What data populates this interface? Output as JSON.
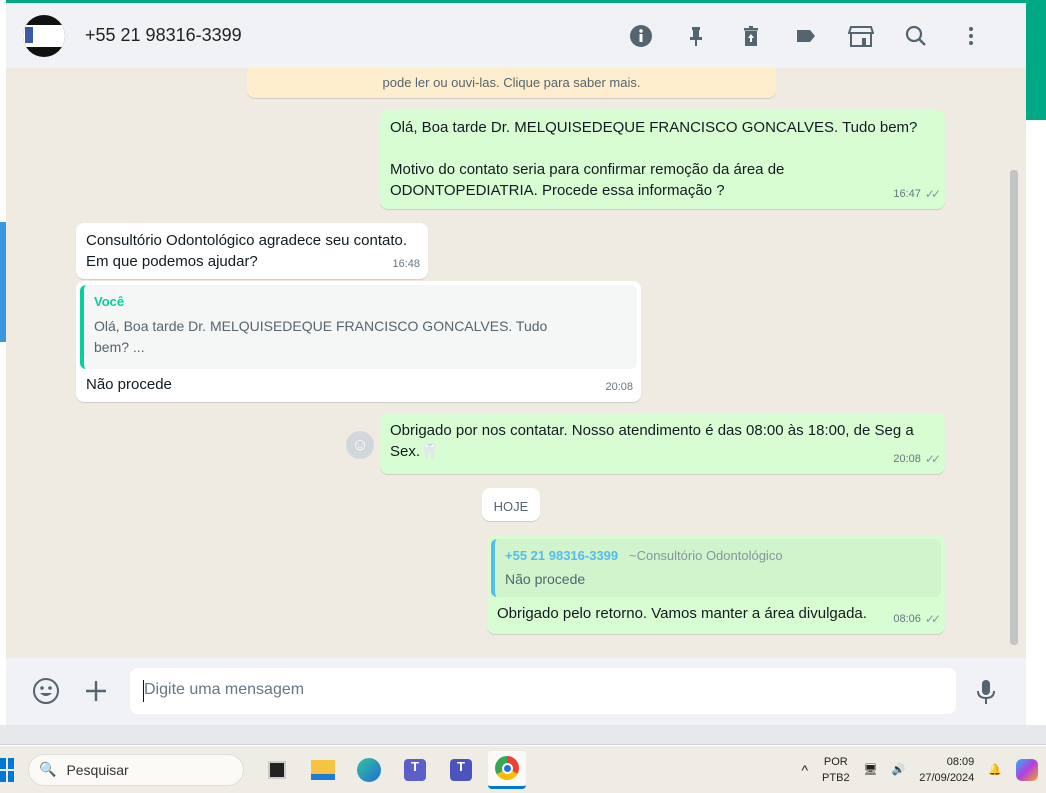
{
  "header": {
    "title": "+55 21 98316-3399",
    "icons": [
      "info-icon",
      "pin-icon",
      "delete-icon",
      "label-icon",
      "catalog-icon",
      "search-icon",
      "menu-icon"
    ]
  },
  "notice": "pode ler ou ouvi-las. Clique para saber mais.",
  "messages": [
    {
      "line1": "Olá, Boa tarde Dr. MELQUISEDEQUE FRANCISCO GONCALVES. Tudo bem?",
      "line2": "Motivo do contato seria para confirmar remoção da área de",
      "line3": "ODONTOPEDIATRIA. Procede essa informação ?",
      "time": "16:47"
    },
    {
      "line1": "Consultório Odontológico agradece seu contato.",
      "line2": "Em que podemos ajudar?",
      "time": "16:48"
    },
    {
      "quote_author": "Você",
      "quote_line1": "Olá, Boa tarde Dr. MELQUISEDEQUE FRANCISCO GONCALVES. Tudo",
      "quote_line2": "bem? ...",
      "text": "Não procede",
      "time": "20:08"
    },
    {
      "line1": "Obrigado por nos contatar. Nosso atendimento é das 08:00 às 18:00, de Seg a",
      "line2": "Sex.🦷",
      "time": "20:08"
    },
    {
      "quote_author": "+55 21 98316-3399",
      "quote_name": "~Consultório Odontológico",
      "quote_text": "Não procede",
      "text": "Obrigado pelo retorno. Vamos manter a área divulgada.",
      "time": "08:06"
    }
  ],
  "date_chip": "HOJE",
  "composer": {
    "placeholder": "Digite uma mensagem"
  },
  "taskbar": {
    "search": "Pesquisar",
    "lang1": "POR",
    "lang2": "PTB2",
    "time": "08:09",
    "date": "27/09/2024"
  }
}
